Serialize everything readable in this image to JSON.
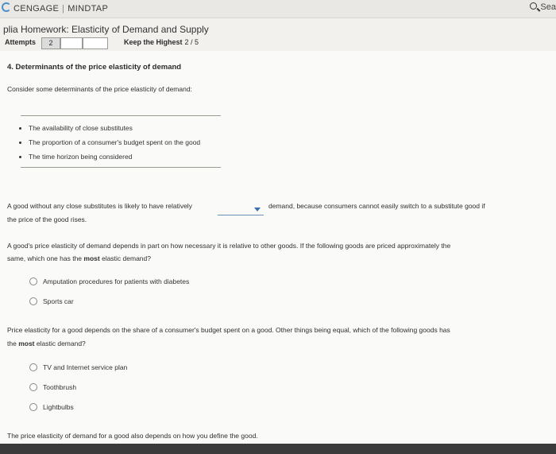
{
  "header": {
    "brand_left": "CENGAGE",
    "brand_right": "MINDTAP",
    "search_label": "Sea"
  },
  "homework": {
    "title": "plia Homework: Elasticity of Demand and Supply",
    "attempts_label": "Attempts",
    "attempt_value": "2",
    "keep_label": "Keep the Highest",
    "keep_score": "2 / 5"
  },
  "question": {
    "heading": "4. Determinants of the price elasticity of demand",
    "intro": "Consider some determinants of the price elasticity of demand:",
    "determinants": [
      "The availability of close substitutes",
      "The proportion of a consumer's budget spent on the good",
      "The time horizon being considered"
    ],
    "q1_before": "A good without any close substitutes is likely to have relatively",
    "q1_after": "demand, because consumers cannot easily switch to a substitute good if",
    "q1_line2": "the price of the good rises.",
    "q2_line1": "A good's price elasticity of demand depends in part on how necessary it is relative to other goods. If the following goods are priced approximately the",
    "q2_line2_pre": "same, which one has the",
    "q2_bold": "most",
    "q2_line2_post": "elastic demand?",
    "q2_options": [
      "Amputation procedures for patients with diabetes",
      "Sports car"
    ],
    "q3_line1": "Price elasticity for a good depends on the share of a consumer's budget spent on a good. Other things being equal, which of the following goods has",
    "q3_pre": "the",
    "q3_bold": "most",
    "q3_post": "elastic demand?",
    "q3_options": [
      "TV and Internet service plan",
      "Toothbrush",
      "Lightbulbs"
    ],
    "footer_text": "The price elasticity of demand for a good also depends on how you define the good."
  }
}
